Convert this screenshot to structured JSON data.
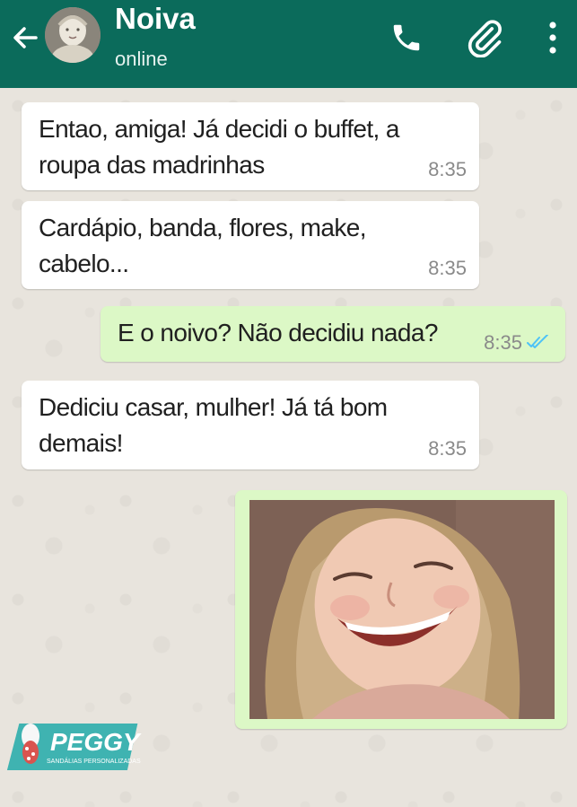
{
  "header": {
    "contact_name": "Noiva",
    "status": "online"
  },
  "messages": [
    {
      "direction": "in",
      "lines": [
        "Entao, amiga! Já decidi o buffet, a",
        "roupa das madrinhas"
      ],
      "time": "8:35"
    },
    {
      "direction": "in",
      "lines": [
        "Cardápio, banda, flores, make,",
        "cabelo..."
      ],
      "time": "8:35"
    },
    {
      "direction": "out",
      "lines": [
        "E o noivo? Não decidiu nada?"
      ],
      "time": "8:35",
      "status": "read"
    },
    {
      "direction": "in",
      "lines": [
        "Dediciu casar, mulher! Já tá bom",
        "demais!"
      ],
      "time": "8:35"
    }
  ],
  "image_message": {
    "direction": "out",
    "content": "photo of a smiling little girl"
  },
  "watermark": {
    "brand": "PEGGY",
    "tagline": "SANDÁLIAS PERSONALIZADAS"
  },
  "colors": {
    "header": "#0b6b5b",
    "chat_background": "#e8e4dd",
    "incoming_bubble": "#ffffff",
    "outgoing_bubble": "#dcf8c6",
    "read_ticks": "#4fc3f7",
    "logo_teal": "#3fb3b1",
    "logo_red": "#d9544f"
  },
  "icons": [
    "back-arrow-icon",
    "phone-icon",
    "paperclip-icon",
    "more-vert-icon",
    "double-check-icon"
  ]
}
